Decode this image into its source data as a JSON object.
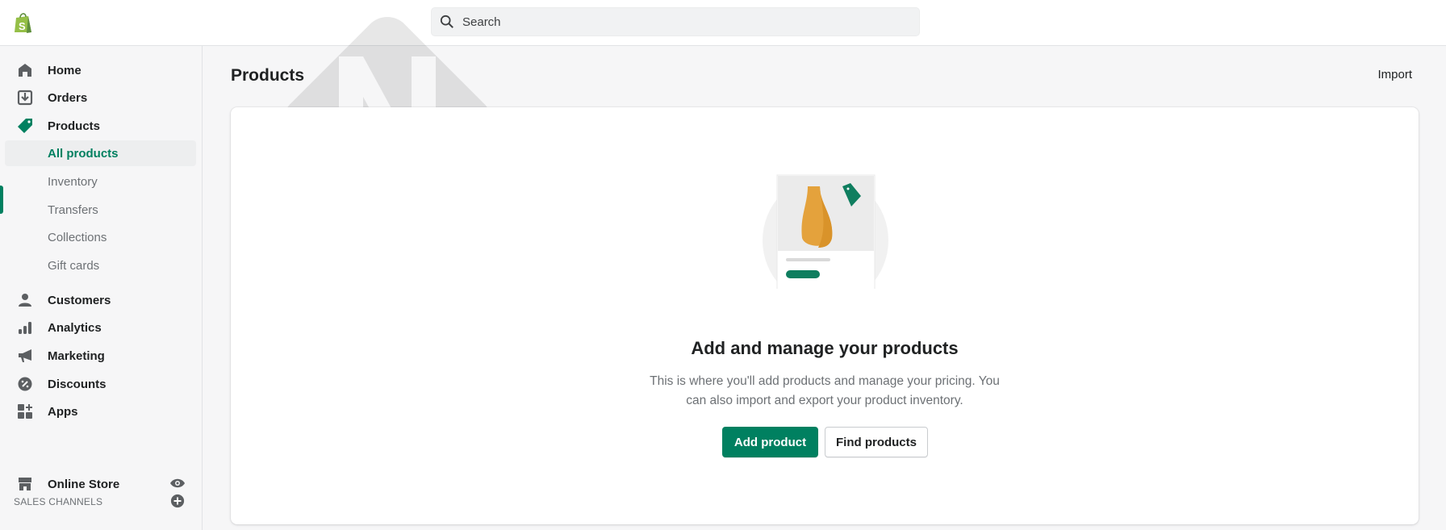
{
  "topbar": {
    "search_placeholder": "Search",
    "logo": "shopify-bag-logo"
  },
  "sidebar": {
    "items": [
      {
        "label": "Home",
        "icon": "home-icon"
      },
      {
        "label": "Orders",
        "icon": "orders-icon"
      },
      {
        "label": "Products",
        "icon": "tag-icon"
      },
      {
        "label": "All products"
      },
      {
        "label": "Inventory"
      },
      {
        "label": "Transfers"
      },
      {
        "label": "Collections"
      },
      {
        "label": "Gift cards"
      },
      {
        "label": "Customers",
        "icon": "person-icon"
      },
      {
        "label": "Analytics",
        "icon": "bar-chart-icon"
      },
      {
        "label": "Marketing",
        "icon": "megaphone-icon"
      },
      {
        "label": "Discounts",
        "icon": "discount-badge-icon"
      },
      {
        "label": "Apps",
        "icon": "apps-icon"
      }
    ],
    "sales_channels_label": "SALES CHANNELS",
    "online_store": "Online Store"
  },
  "page": {
    "title": "Products",
    "import_label": "Import"
  },
  "empty_state": {
    "heading": "Add and manage your products",
    "text": "This is where you'll add products and manage your pricing. You can also import and export your product inventory.",
    "primary_label": "Add product",
    "secondary_label": "Find products"
  },
  "colors": {
    "accent": "#008060",
    "vase": "#e4a23c"
  }
}
